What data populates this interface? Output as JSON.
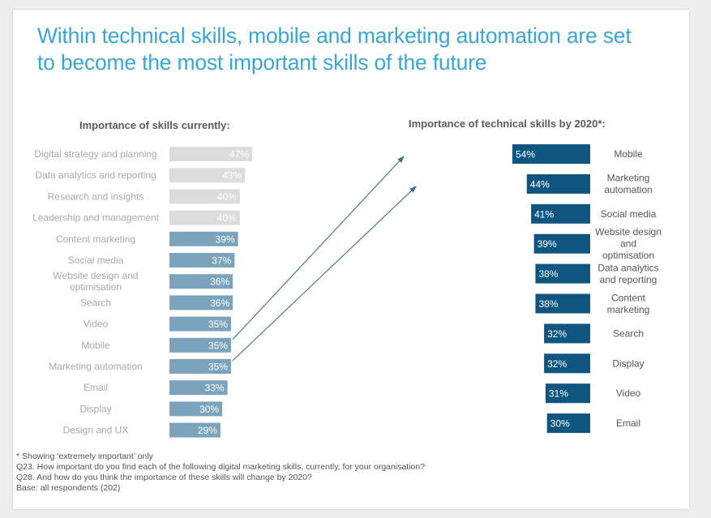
{
  "title": "Within technical skills, mobile and marketing automation are set to become the most important skills of the future",
  "colors": {
    "title": "#3aa6d3",
    "left_muted_bar": "#dcdcdc",
    "left_bar": "#7ba4bc",
    "right_bar": "#0e5680",
    "muted_label": "#a9a9a9",
    "right_label": "#555555",
    "arrow": "#3c6e8c"
  },
  "footnotes": [
    "* Showing ‘extremely important’ only",
    "Q23. How important do you find each of the following digital marketing skills, currently, for your organisation?",
    "Q28. And how do you think the importance of these skills will change by 2020?",
    "Base: all respondents (202)"
  ],
  "chart_data": [
    {
      "type": "bar",
      "orientation": "horizontal",
      "title": "Importance of skills currently:",
      "categories": [
        "Digital strategy and planning",
        "Data analytics and reporting",
        "Research and insights",
        "Leadership and management",
        "Content marketing",
        "Social media",
        "Website design and optimisation",
        "Search",
        "Video",
        "Mobile",
        "Marketing automation",
        "Email",
        "Display",
        "Design and UX"
      ],
      "values": [
        47,
        43,
        40,
        40,
        39,
        37,
        36,
        36,
        35,
        35,
        35,
        33,
        30,
        29
      ],
      "labels": [
        "47%",
        "43%",
        "40%",
        "40%",
        "39%",
        "37%",
        "36%",
        "36%",
        "35%",
        "35%",
        "35%",
        "33%",
        "30%",
        "29%"
      ],
      "muted": [
        true,
        true,
        true,
        true,
        false,
        false,
        false,
        false,
        false,
        false,
        false,
        false,
        false,
        false
      ],
      "unit": "%",
      "xlabel": "",
      "ylabel": "",
      "grid": false
    },
    {
      "type": "bar",
      "orientation": "horizontal",
      "title": "Importance of technical skills by 2020*:",
      "categories": [
        "Mobile",
        "Marketing automation",
        "Social media",
        "Website design and optimisation",
        "Data analytics and reporting",
        "Content marketing",
        "Search",
        "Display",
        "Video",
        "Email"
      ],
      "values": [
        54,
        44,
        41,
        39,
        38,
        38,
        32,
        32,
        31,
        30
      ],
      "labels": [
        "54%",
        "44%",
        "41%",
        "39%",
        "38%",
        "38%",
        "32%",
        "32%",
        "31%",
        "30%"
      ],
      "unit": "%",
      "xlabel": "",
      "ylabel": "",
      "grid": false,
      "annotations": [
        "Arrow from current 'Mobile' to 2020 'Mobile'",
        "Arrow from current 'Marketing automation' to 2020 'Marketing automation'"
      ]
    }
  ]
}
